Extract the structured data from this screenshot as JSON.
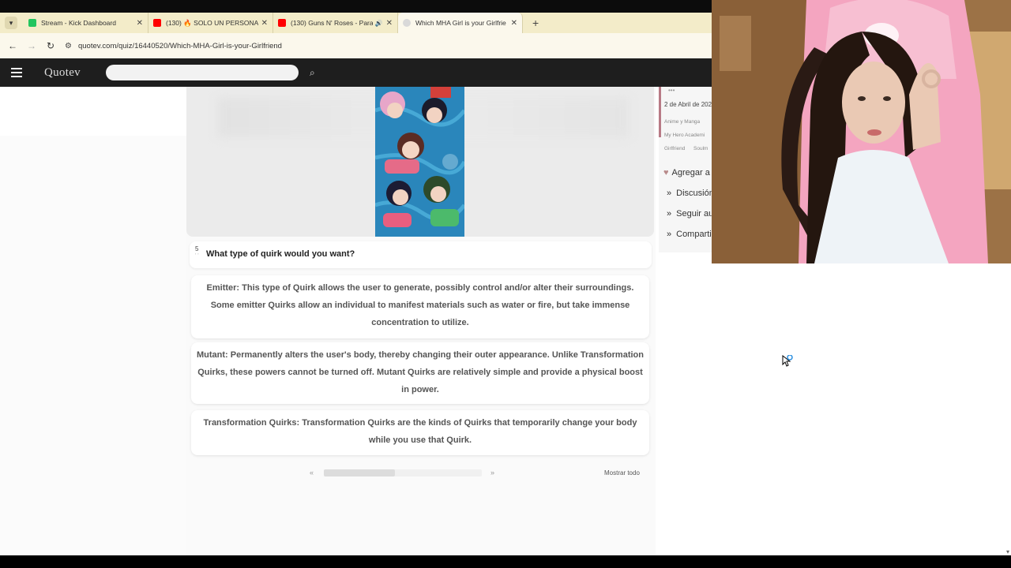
{
  "browser": {
    "tabs": [
      {
        "title": "Stream - Kick Dashboard",
        "favicon_color": "#22c55e",
        "active": false
      },
      {
        "title": "(130) 🔥 SOLO UN PERSONAJE",
        "favicon_color": "#ff0000",
        "active": false
      },
      {
        "title": "(130) Guns N' Roses - Paradi",
        "favicon_color": "#ff0000",
        "active": false,
        "audio": true
      },
      {
        "title": "Which MHA Girl is your Girlfrie",
        "favicon_color": "#cfcfcf",
        "active": true
      }
    ],
    "url": "quotev.com/quiz/16440520/Which-MHA-Girl-is-your-Girlfriend"
  },
  "site": {
    "logo": "Quotev"
  },
  "question": {
    "number": "5",
    "text": "What type of quirk would you want?"
  },
  "answers": [
    {
      "text": "Emitter: This type of Quirk allows the user to generate, possibly control and/or alter their surroundings. Some emitter Quirks allow an individual to manifest materials such as water or fire, but take immense concentration to utilize."
    },
    {
      "text": "Mutant: Permanently alters the user's body, thereby changing their outer appearance. Unlike Transformation Quirks, these powers cannot be turned off. Mutant Quirks are relatively simple and provide a physical boost in power."
    },
    {
      "text": "Transformation Quirks: Transformation Quirks are the kinds of Quirks that temporarily change your body while you use that Quirk."
    }
  ],
  "pager": {
    "prev": "«",
    "next": "»",
    "progress": 0.45,
    "show_all": "Mostrar todo"
  },
  "sidebar": {
    "date": "2 de Abril de 202",
    "tags": [
      "Anime y Manga",
      "My Hero Academi",
      "Girlfriend",
      "Soulm"
    ],
    "links": [
      {
        "label": "Agregar a",
        "icon": "heart-icon"
      },
      {
        "label": "Discusión",
        "icon": "chevron-icon"
      },
      {
        "label": "Seguir au",
        "icon": "chevron-icon"
      },
      {
        "label": "Compartir",
        "icon": "chevron-icon"
      }
    ]
  },
  "colors": {
    "tabbar": "#f3ecc9",
    "header": "#1e1e1e",
    "accent": "#b87a86"
  }
}
